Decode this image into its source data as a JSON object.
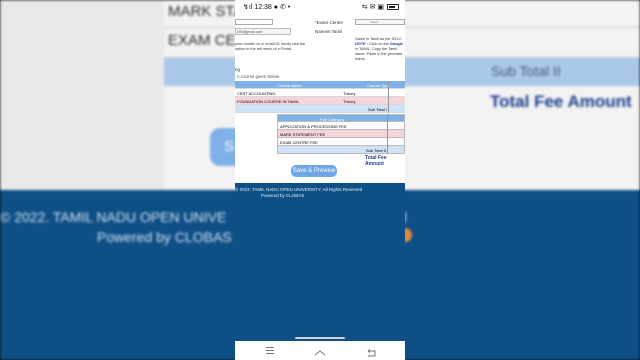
{
  "background": {
    "rows": [
      "MARK STA",
      "EXAM CEN"
    ],
    "subtotal_label": "Sub Total II",
    "total_label": "Total Fee Amount",
    "button_fragment": "S",
    "copyright_fragment": "© 2022. TAMIL NADU OPEN UNIVE",
    "copyright_tail": "d",
    "powered_fragment": "Powered by CLOBAS"
  },
  "status": {
    "left": "↯ıl 12:38 ● ✆ •",
    "right": "⇆ ✉ ▣"
  },
  "form": {
    "email_value": "000@gmail.com",
    "exam_centre_label": "*Exam Centre",
    "name_tamil_label": "Namein Tamil",
    "select_right_text": "Select",
    "left_note": "your mobile no or email ID, kindly visit the option in the left menu of e-Portal.",
    "right_note_1": "Name in Tamil as per SSLC",
    "right_note_bold": "NOTE :",
    "right_note_2": "Click on the",
    "right_note_link": "Google",
    "right_note_3": "in TAMIL. Copy the Tamil name. Paste in the provided frame."
  },
  "course_section": {
    "caption": "ng",
    "hint": "n course given below",
    "headers": [
      "Course Name",
      "Course Type"
    ],
    "rows": [
      {
        "name": "CERT ACCOUNTING",
        "type": "Theory"
      },
      {
        "name": "FOUNDATION COURSE IN TAMIL",
        "type": "Theory"
      }
    ],
    "subtotal": "Sub Total I"
  },
  "fee_section": {
    "header": "Fee Category",
    "rows": [
      "APPLICATION & PROCESSING FEE",
      "MARK STATEMENT FEE",
      "EXAM CENTRE FEE"
    ],
    "subtotal": "Sub Total II",
    "total": "Total Fee Amount"
  },
  "save_button": "Save & Preview",
  "footer": {
    "copyright": "© 2022. TAMIL NADU OPEN UNIVERSITY. All Rights Reserved",
    "powered": "Powered by CLOBAS"
  }
}
